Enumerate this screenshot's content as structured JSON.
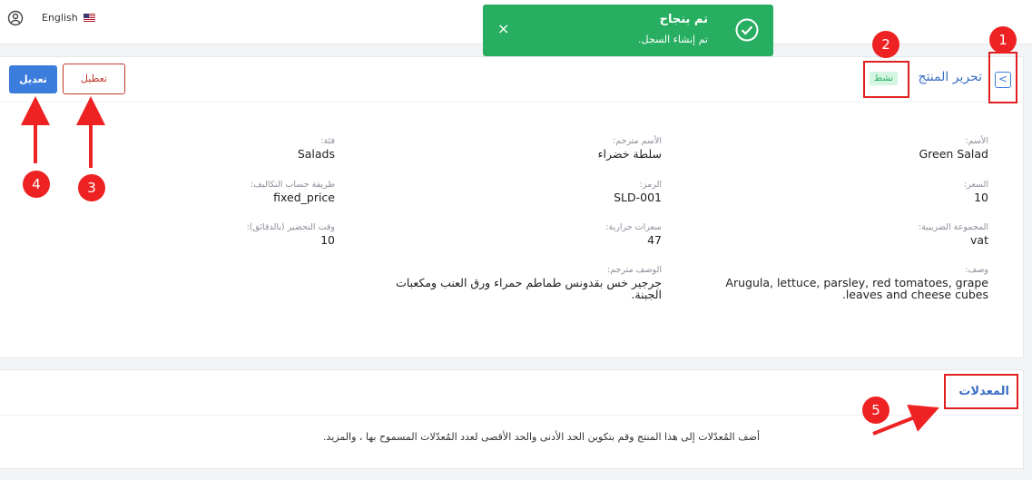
{
  "topbar": {
    "language": "English"
  },
  "toast": {
    "title": "تم بنجاح",
    "message": "تم إنشاء السجل.",
    "close": "×"
  },
  "product": {
    "back_icon": "chevron-left-icon",
    "title": "تحرير المنتج",
    "status": "نشط",
    "edit_label": "تعديل",
    "disable_label": "تعطيل",
    "fields": {
      "name": {
        "label": "الأسم:",
        "value": "Green Salad"
      },
      "translated_name": {
        "label": "الأسم مترجم:",
        "value": "سلطة خضراء"
      },
      "category": {
        "label": "فئة:",
        "value": "Salads"
      },
      "price": {
        "label": "السعر:",
        "value": "10"
      },
      "code": {
        "label": "الرمز:",
        "value": "SLD-001"
      },
      "cost_method": {
        "label": "طريقة حساب التكاليف:",
        "value": "fixed_price"
      },
      "tax_group": {
        "label": "المجموعة الضريبية:",
        "value": "vat"
      },
      "calories": {
        "label": "سعرات حرارية:",
        "value": "47"
      },
      "prep_time": {
        "label": "وقت التحضير (بالدقائق):",
        "value": "10"
      },
      "description": {
        "label": "وصف:",
        "value": "Arugula, lettuce, parsley, red tomatoes, grape leaves and cheese cubes."
      },
      "translated_description": {
        "label": "الوصف مترجم:",
        "value": "جرجير خس بقدونس طماطم حمراء ورق العنب ومكعبات الجبنة."
      }
    }
  },
  "modifiers": {
    "title": "المعدلات",
    "description": "أضف المُعدّلات إلى هذا المنتج وقم بتكوين الحد الأدنى والحد الأقصى لعدد المُعدّلات المسموح بها ، والمزيد."
  },
  "annotations": [
    "1",
    "2",
    "3",
    "4",
    "5"
  ],
  "colors": {
    "primary": "#3b7ddd",
    "success": "#27ae60",
    "danger": "#c0392b",
    "annotation": "#ee2222"
  }
}
